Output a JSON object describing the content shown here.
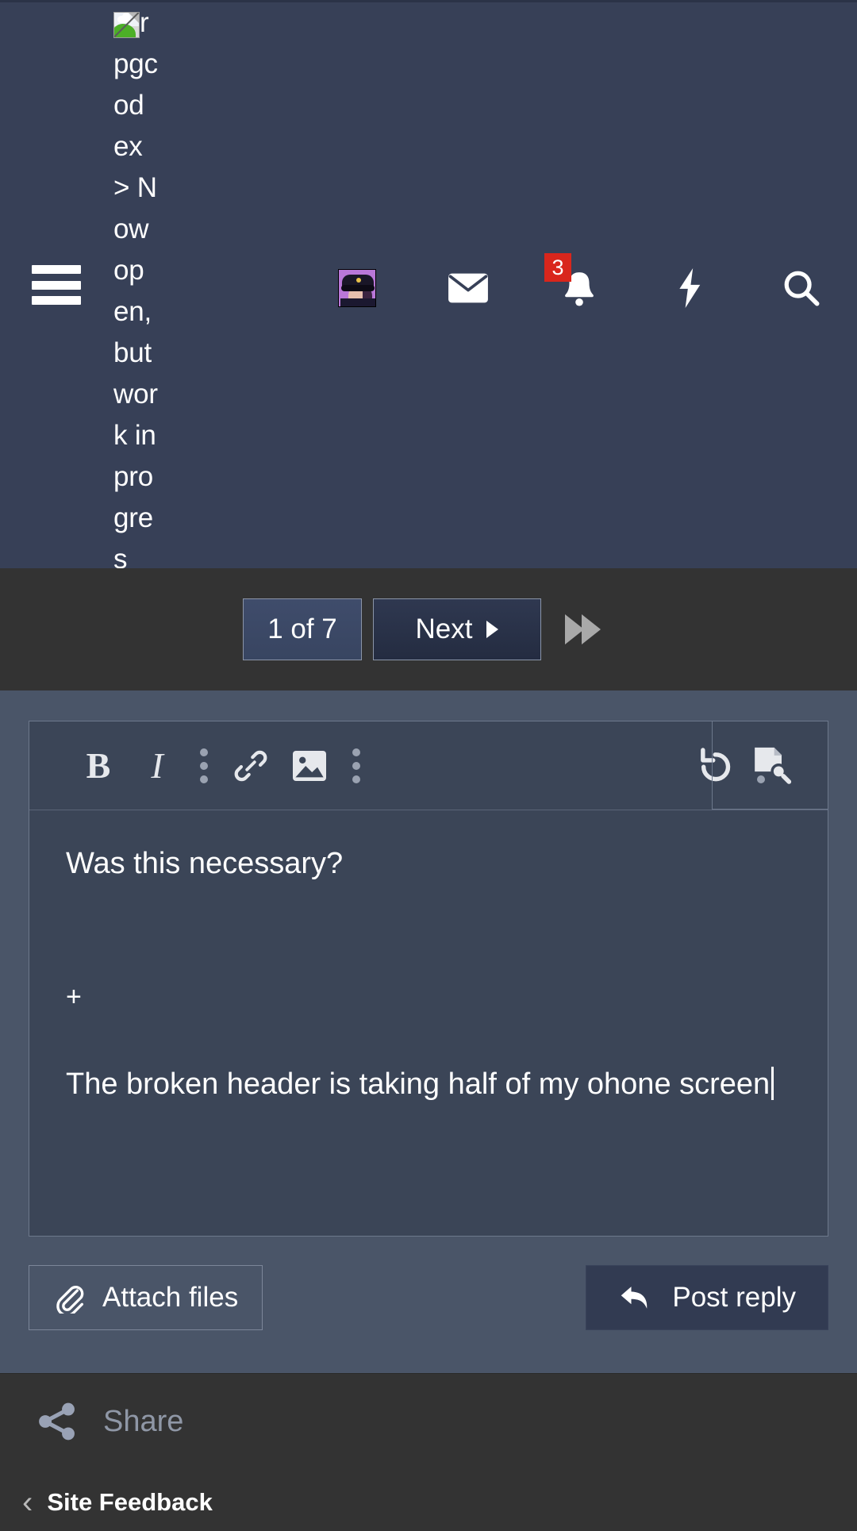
{
  "header": {
    "menu_icon": "hamburger-menu-icon",
    "broken_logo_alt": "rpgcodex > Now open, but work in progress...",
    "icons": [
      {
        "name": "user-avatar",
        "label": ""
      },
      {
        "name": "inbox-envelope-icon",
        "label": ""
      },
      {
        "name": "notifications-bell-icon",
        "label": "",
        "badge": "3"
      },
      {
        "name": "whats-new-lightning-icon",
        "label": ""
      },
      {
        "name": "search-icon",
        "label": ""
      }
    ],
    "notification_count": "3",
    "badge_color": "#d9261c",
    "background": "#374057"
  },
  "pagination": {
    "current_page_label": "1 of 7",
    "next_label": "Next",
    "last_page_icon": "fast-forward-icon",
    "background": "#333333",
    "active_color": "#3f4c6b"
  },
  "editor": {
    "toolbar": [
      {
        "name": "bold-button",
        "glyph": "B"
      },
      {
        "name": "italic-button",
        "glyph": "I"
      },
      {
        "name": "text-more-menu",
        "glyph": "⋮"
      },
      {
        "name": "insert-link-button",
        "glyph": "link-icon"
      },
      {
        "name": "insert-image-button",
        "glyph": "image-icon"
      },
      {
        "name": "insert-more-menu",
        "glyph": "⋮"
      },
      {
        "name": "undo-button",
        "glyph": "undo-icon"
      },
      {
        "name": "editor-more-menu",
        "glyph": "⋮"
      },
      {
        "name": "preview-button",
        "glyph": "document-search-icon"
      }
    ],
    "content": {
      "quote_line": "Was this necessary?",
      "plus_marker": "+",
      "reply_text": "The broken header is taking half of my ohone screen"
    },
    "attach_label": "Attach files",
    "post_label": "Post reply",
    "background": "#4a5568",
    "field_background": "#3b4557"
  },
  "footer": {
    "share_label": "Share",
    "breadcrumb_label": "Site Feedback",
    "background": "#333333"
  }
}
